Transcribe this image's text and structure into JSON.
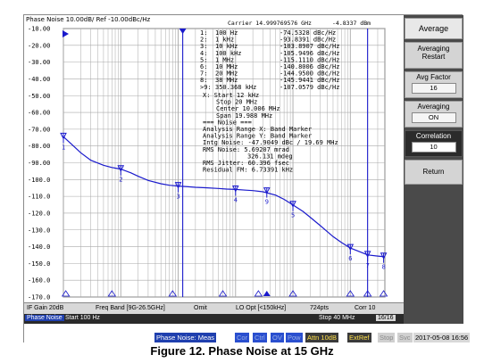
{
  "header": {
    "title": "Phase Noise 10.00dB/ Ref -10.00dBc/Hz",
    "carrier": "Carrier 14.999769576 GHz",
    "carrier_power": "-4.8337 dBm"
  },
  "marker_table": [
    {
      "id": "1:",
      "offset": "100 Hz",
      "value": "-74.5328 dBc/Hz"
    },
    {
      "id": "2:",
      "offset": "1 kHz",
      "value": "-93.8391 dBc/Hz"
    },
    {
      "id": "3:",
      "offset": "10 kHz",
      "value": "-103.8907 dBc/Hz"
    },
    {
      "id": "4:",
      "offset": "100 kHz",
      "value": "-105.9496 dBc/Hz"
    },
    {
      "id": "5:",
      "offset": "1 MHz",
      "value": "-115.1110 dBc/Hz"
    },
    {
      "id": "6:",
      "offset": "10 MHz",
      "value": "-140.8006 dBc/Hz"
    },
    {
      "id": "7:",
      "offset": "20 MHz",
      "value": "-144.9500 dBc/Hz"
    },
    {
      "id": "8:",
      "offset": "38 MHz",
      "value": "-145.9441 dBc/Hz"
    },
    {
      "id": ">9:",
      "offset": "350.368 kHz",
      "value": "-107.0579 dBc/Hz"
    }
  ],
  "analysis": [
    "X: Start 12 kHz",
    "Stop 20 MHz",
    "Center 10.006 MHz",
    "Span 19.988 MHz",
    "=== Noise ===",
    "Analysis Range X: Band Marker",
    "Analysis Range Y: Band Marker",
    "Intg Noise: -47.9049 dBc / 19.69 MHz",
    "RMS Noise: 5.69207 mrad",
    "326.131 mdeg",
    "RMS Jitter: 60.396 fsec",
    "Residual FM: 6.73391 kHz"
  ],
  "chart_data": {
    "type": "line",
    "title": "Phase Noise 10.00dB/ Ref -10.00dBc/Hz",
    "xlabel": "",
    "ylabel": "",
    "x_scale": "log",
    "xlim": [
      100,
      40000000
    ],
    "ylim": [
      -170,
      -10
    ],
    "yticks": [
      -10,
      -20,
      -30,
      -40,
      -50,
      -60,
      -70,
      -80,
      -90,
      -100,
      -110,
      -120,
      -130,
      -140,
      -150,
      -160,
      -170
    ],
    "ytick_labels": [
      "-10.00",
      "-20.00",
      "-30.00",
      "-40.00",
      "-50.00",
      "-60.00",
      "-70.00",
      "-80.00",
      "-90.00",
      "-100.0",
      "-110.0",
      "-120.0",
      "-130.0",
      "-140.0",
      "-150.0",
      "-160.0",
      "-170.0"
    ],
    "grid": true,
    "series": [
      {
        "x": [
          100,
          150,
          200,
          300,
          500,
          700,
          1000,
          1500,
          2000,
          3000,
          5000,
          7000,
          10000,
          15000,
          20000,
          30000,
          50000,
          70000,
          100000,
          150000,
          200000,
          300000,
          500000,
          700000,
          1000000,
          1500000,
          2000000,
          3000000,
          5000000,
          7000000,
          10000000,
          15000000,
          20000000,
          30000000,
          40000000
        ],
        "y": [
          -74.5,
          -80,
          -84,
          -88.5,
          -91.5,
          -92.8,
          -93.8,
          -96,
          -98,
          -100.5,
          -102.5,
          -103.4,
          -103.9,
          -104.3,
          -104.6,
          -104.9,
          -105.3,
          -105.7,
          -105.9,
          -106.3,
          -106.6,
          -107.3,
          -109.3,
          -111.8,
          -115.1,
          -119,
          -122.5,
          -127.5,
          -134,
          -137.5,
          -140.8,
          -143.2,
          -144.9,
          -145.6,
          -146
        ]
      }
    ],
    "markers": [
      {
        "label": "1",
        "x": 100,
        "y": -74.5328
      },
      {
        "label": "2",
        "x": 1000,
        "y": -93.8391
      },
      {
        "label": "3",
        "x": 10000,
        "y": -103.8907
      },
      {
        "label": "4",
        "x": 100000,
        "y": -105.9496
      },
      {
        "label": "5",
        "x": 1000000,
        "y": -115.111
      },
      {
        "label": "6",
        "x": 10000000,
        "y": -140.8006
      },
      {
        "label": "7",
        "x": 20000000,
        "y": -144.95
      },
      {
        "label": "8",
        "x": 38000000,
        "y": -145.9441
      },
      {
        "label": "9",
        "x": 350368,
        "y": -107.0579
      }
    ],
    "band_x": [
      12000,
      20000000
    ]
  },
  "softkeys": {
    "title": "Average",
    "averaging_restart": "Averaging Restart",
    "avg_factor_label": "Avg Factor",
    "avg_factor_value": "16",
    "averaging_label": "Averaging",
    "averaging_value": "ON",
    "correlation_label": "Correlation",
    "correlation_value": "10",
    "return": "Return"
  },
  "status1": {
    "if_gain": "IF Gain 20dB",
    "freq_band": "Freq Band [9G-26.5GHz]",
    "omit": "Omit",
    "lo_opt": "LO Opt [<150kHz]",
    "points": "724pts",
    "corr": "Corr 10"
  },
  "status2": {
    "mode": "Phase Noise",
    "start": "Start 100 Hz",
    "stop": "Stop 40 MHz",
    "count": "16/16"
  },
  "status3": {
    "meas": "Phase Noise: Meas",
    "cor": "Cor",
    "ctrl": "Ctrl",
    "ov": "OV",
    "pow": "Pow",
    "attn": "Attn 10dB",
    "extref": "ExtRef",
    "stop": "Stop",
    "svc": "Svc",
    "datetime": "2017-05-08 16:56"
  },
  "caption": "Figure 12. Phase Noise at 15 GHz",
  "colors": {
    "trace": "#1a1acc",
    "grid": "#a9a9a9",
    "marker": "#1a1acc",
    "panel": "#4a4a4a"
  }
}
